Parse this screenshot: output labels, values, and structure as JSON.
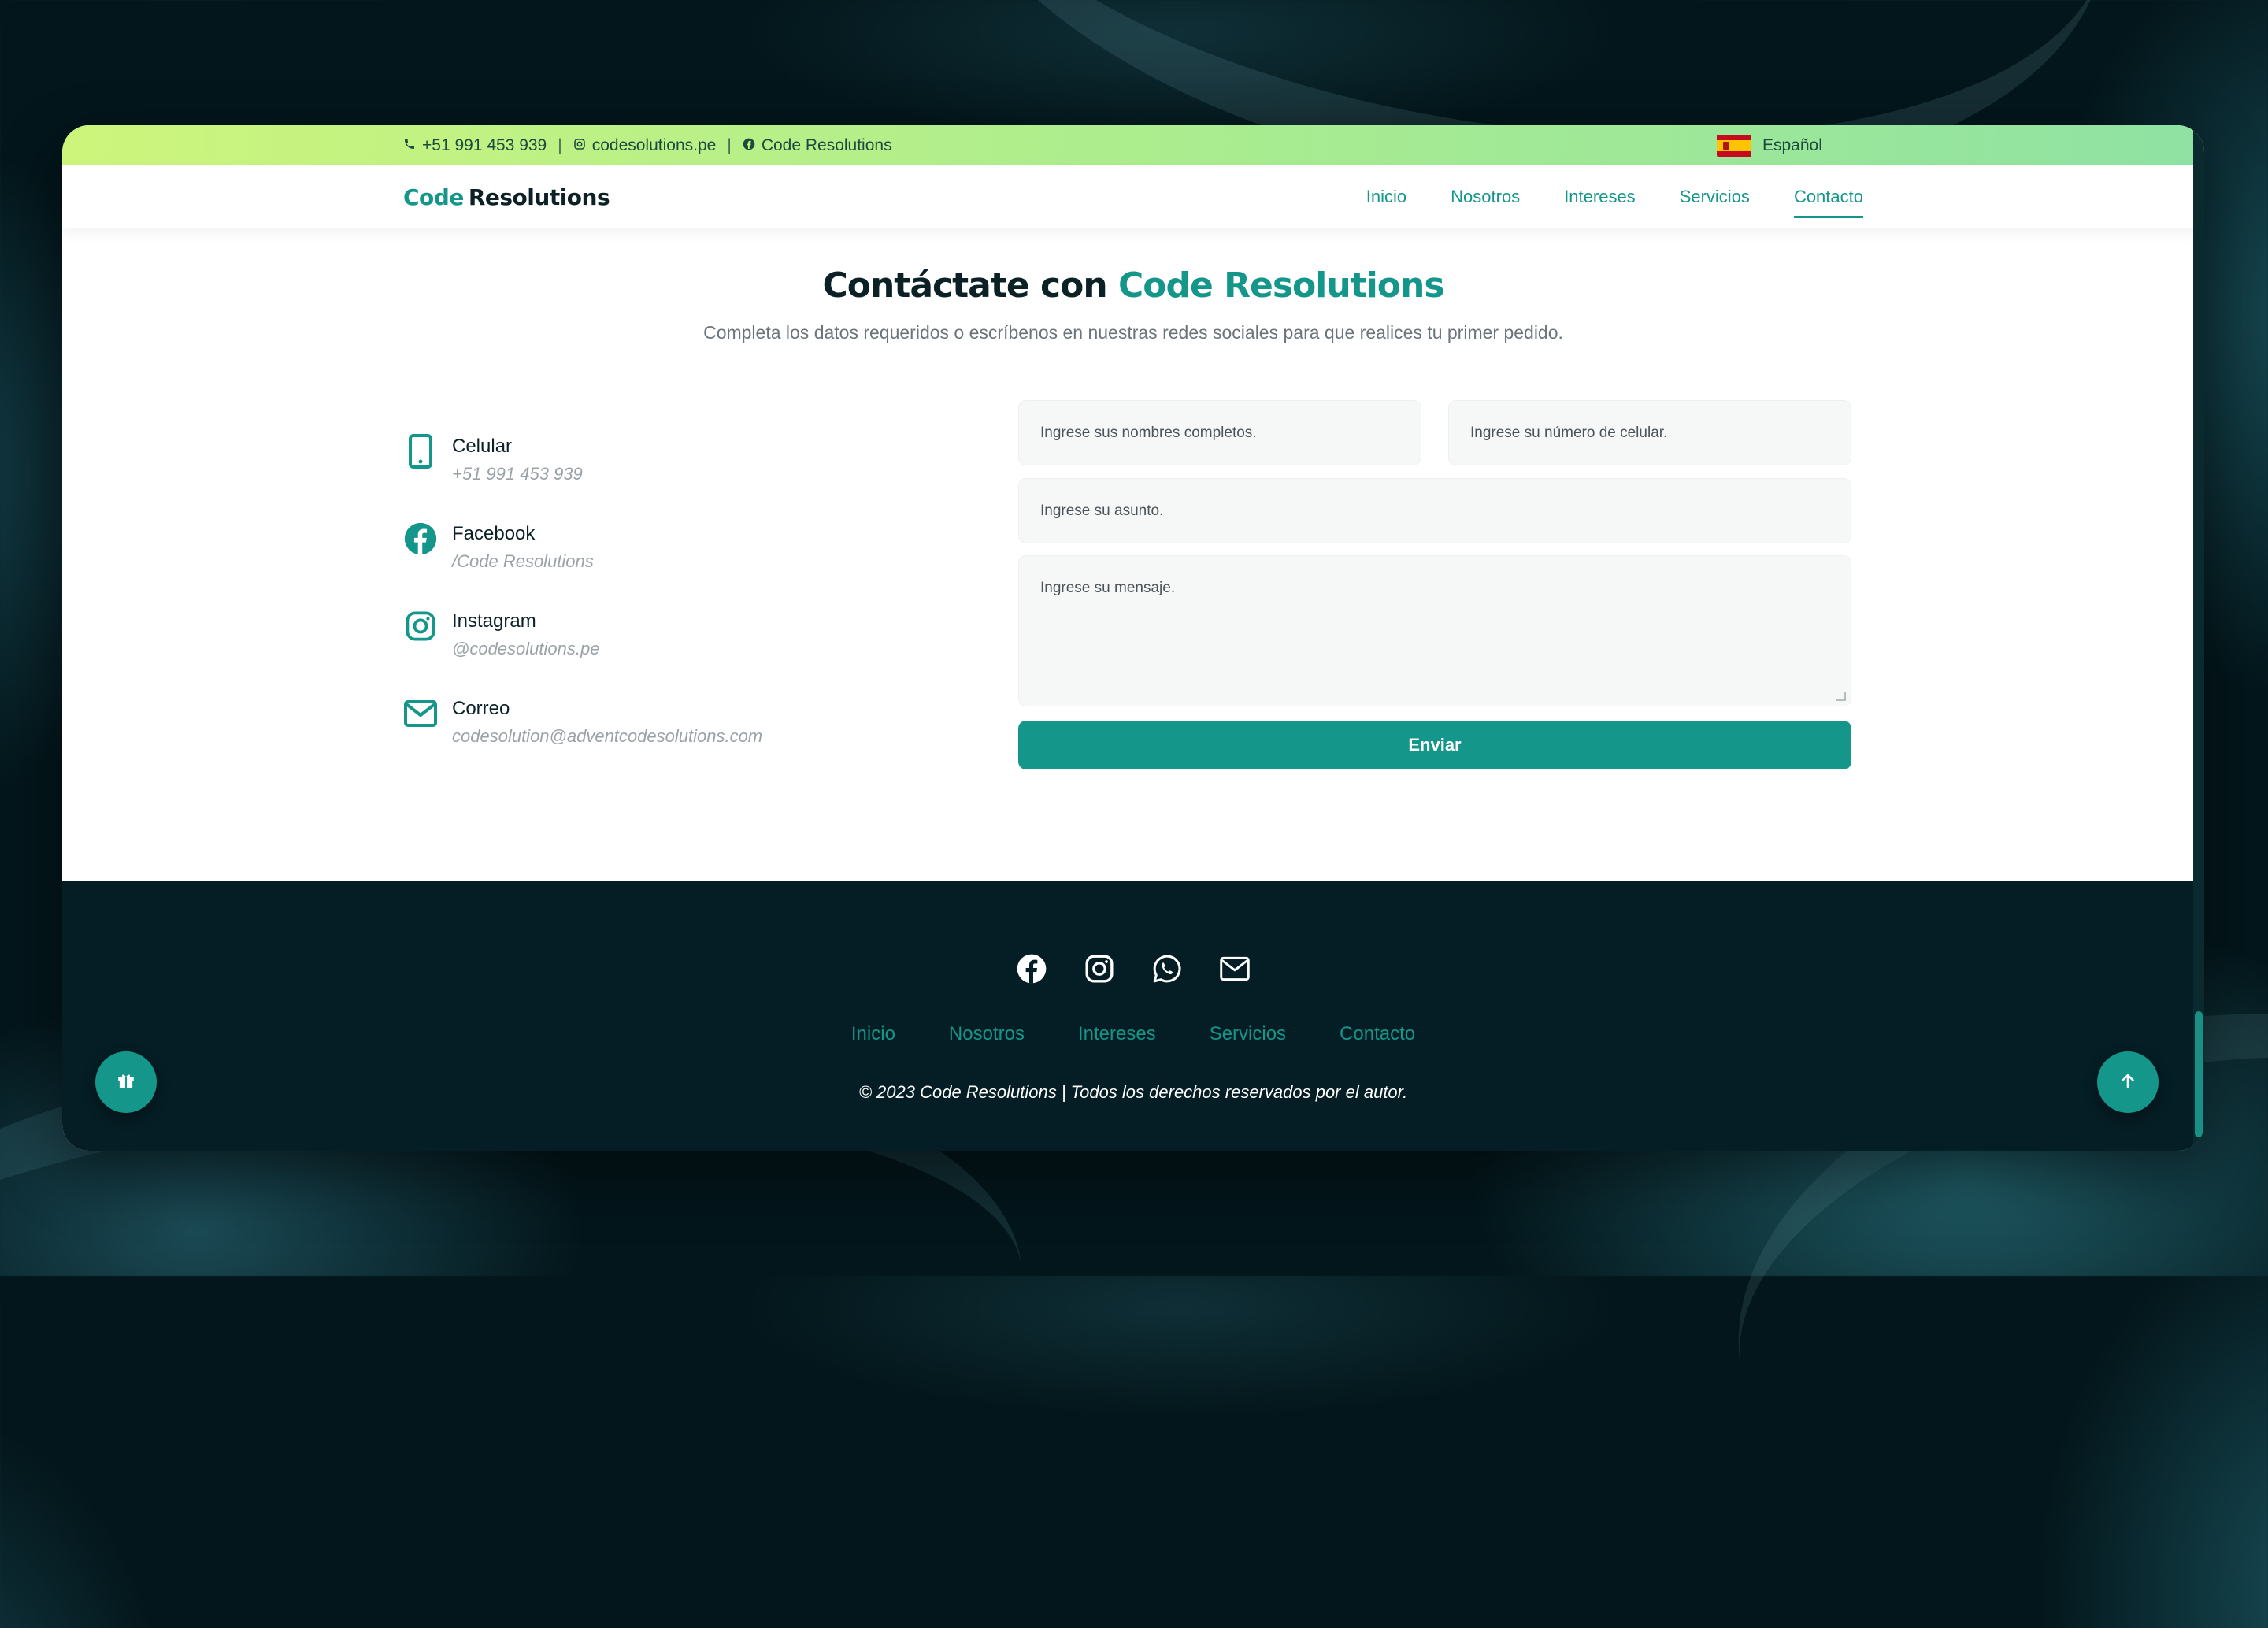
{
  "topbar": {
    "phone": "+51 991 453 939",
    "sep1": "|",
    "instagram": "codesolutions.pe",
    "sep2": "|",
    "facebook": "Code Resolutions",
    "language": "Español"
  },
  "navbar": {
    "logo_part1": "Code",
    "logo_part2": "Resolutions",
    "links": [
      "Inicio",
      "Nosotros",
      "Intereses",
      "Servicios",
      "Contacto"
    ],
    "active": "Contacto"
  },
  "hero": {
    "title_part1": "Contáctate con",
    "title_accent": "Code Resolutions",
    "subtitle": "Completa los datos requeridos o escríbenos en nuestras redes sociales para que realices tu primer pedido."
  },
  "contact": {
    "items": [
      {
        "title": "Celular",
        "value": "+51 991 453 939",
        "icon": "mobile-phone-icon"
      },
      {
        "title": "Facebook",
        "value": "/Code Resolutions",
        "icon": "facebook-icon"
      },
      {
        "title": "Instagram",
        "value": "@codesolutions.pe",
        "icon": "instagram-icon"
      },
      {
        "title": "Correo",
        "value": "codesolution@adventcodesolutions.com",
        "icon": "mail-icon"
      }
    ]
  },
  "form": {
    "name_placeholder": "Ingrese sus nombres completos.",
    "phone_placeholder": "Ingrese su número de celular.",
    "subject_placeholder": "Ingrese su asunto.",
    "message_placeholder": "Ingrese su mensaje.",
    "submit_label": "Enviar"
  },
  "footer": {
    "social_icons": [
      "facebook-icon",
      "instagram-icon",
      "whatsapp-icon",
      "mail-icon"
    ],
    "links": [
      "Inicio",
      "Nosotros",
      "Intereses",
      "Servicios",
      "Contacto"
    ],
    "copyright": "© 2023 Code Resolutions | Todos los derechos reservados por el autor."
  },
  "colors": {
    "accent": "#14968a",
    "dark": "#0b2126",
    "footer_bg": "#051d24",
    "topbar_start": "#cdf57c",
    "topbar_end": "#8fe2a3"
  }
}
